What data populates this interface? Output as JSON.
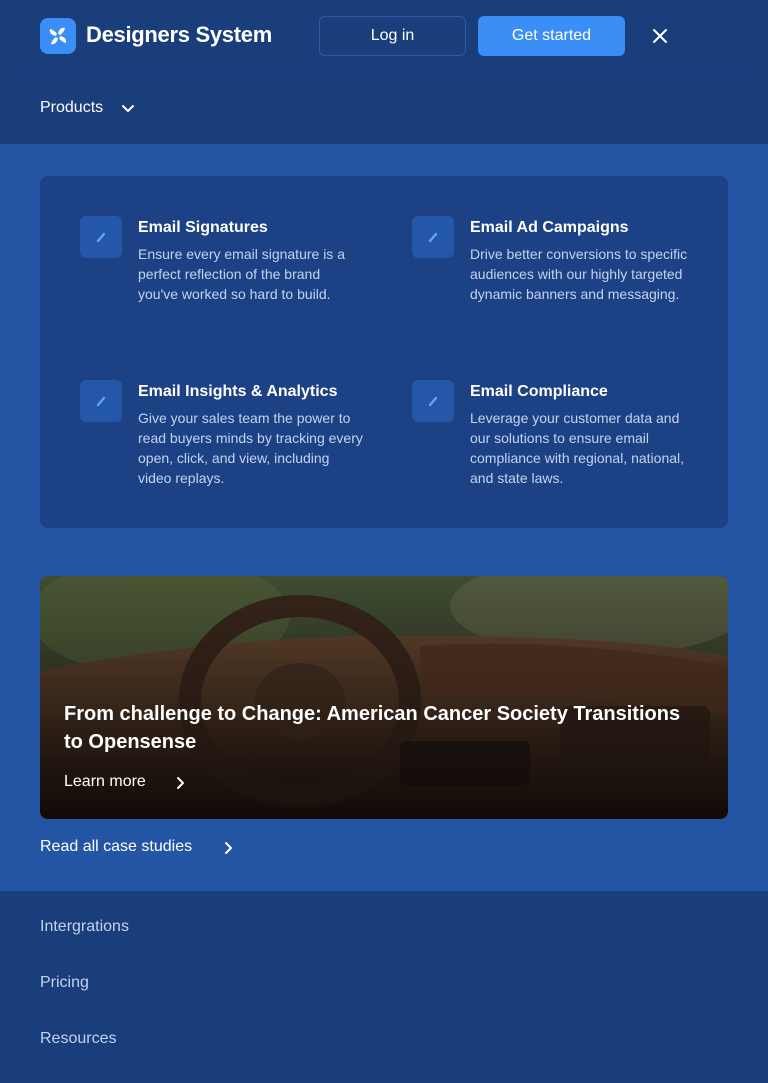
{
  "header": {
    "brand": "Designers System",
    "login_label": "Log in",
    "get_started_label": "Get started"
  },
  "menu": {
    "products_label": "Products",
    "features": [
      {
        "title": "Email Signatures",
        "description": "Ensure every email signature is a perfect reflection of the brand you've worked so hard to build.",
        "icon": "pen-icon"
      },
      {
        "title": "Email Ad Campaigns",
        "description": "Drive better conversions to specific audiences with our highly targeted dynamic banners and messaging.",
        "icon": "pen-icon"
      },
      {
        "title": "Email Insights & Analytics",
        "description": "Give your sales team the power to read buyers minds by tracking every open, click, and view, including video replays.",
        "icon": "pen-icon"
      },
      {
        "title": "Email Compliance",
        "description": "Leverage your customer data and our solutions to ensure email compliance with regional, national, and state laws.",
        "icon": "pen-icon"
      }
    ],
    "case_study": {
      "title": "From challenge to Change: American Cancer Society Transitions to Opensense",
      "link_label": "Learn more"
    },
    "read_all_label": "Read all case studies",
    "nav_items": [
      "Intergrations",
      "Pricing",
      "Resources"
    ]
  },
  "colors": {
    "header_bg": "#1a3d7c",
    "section_bg": "#2455a5",
    "panel_bg": "#1c4285",
    "accent": "#3b8ef5",
    "muted_text": "#c3d3ee"
  }
}
